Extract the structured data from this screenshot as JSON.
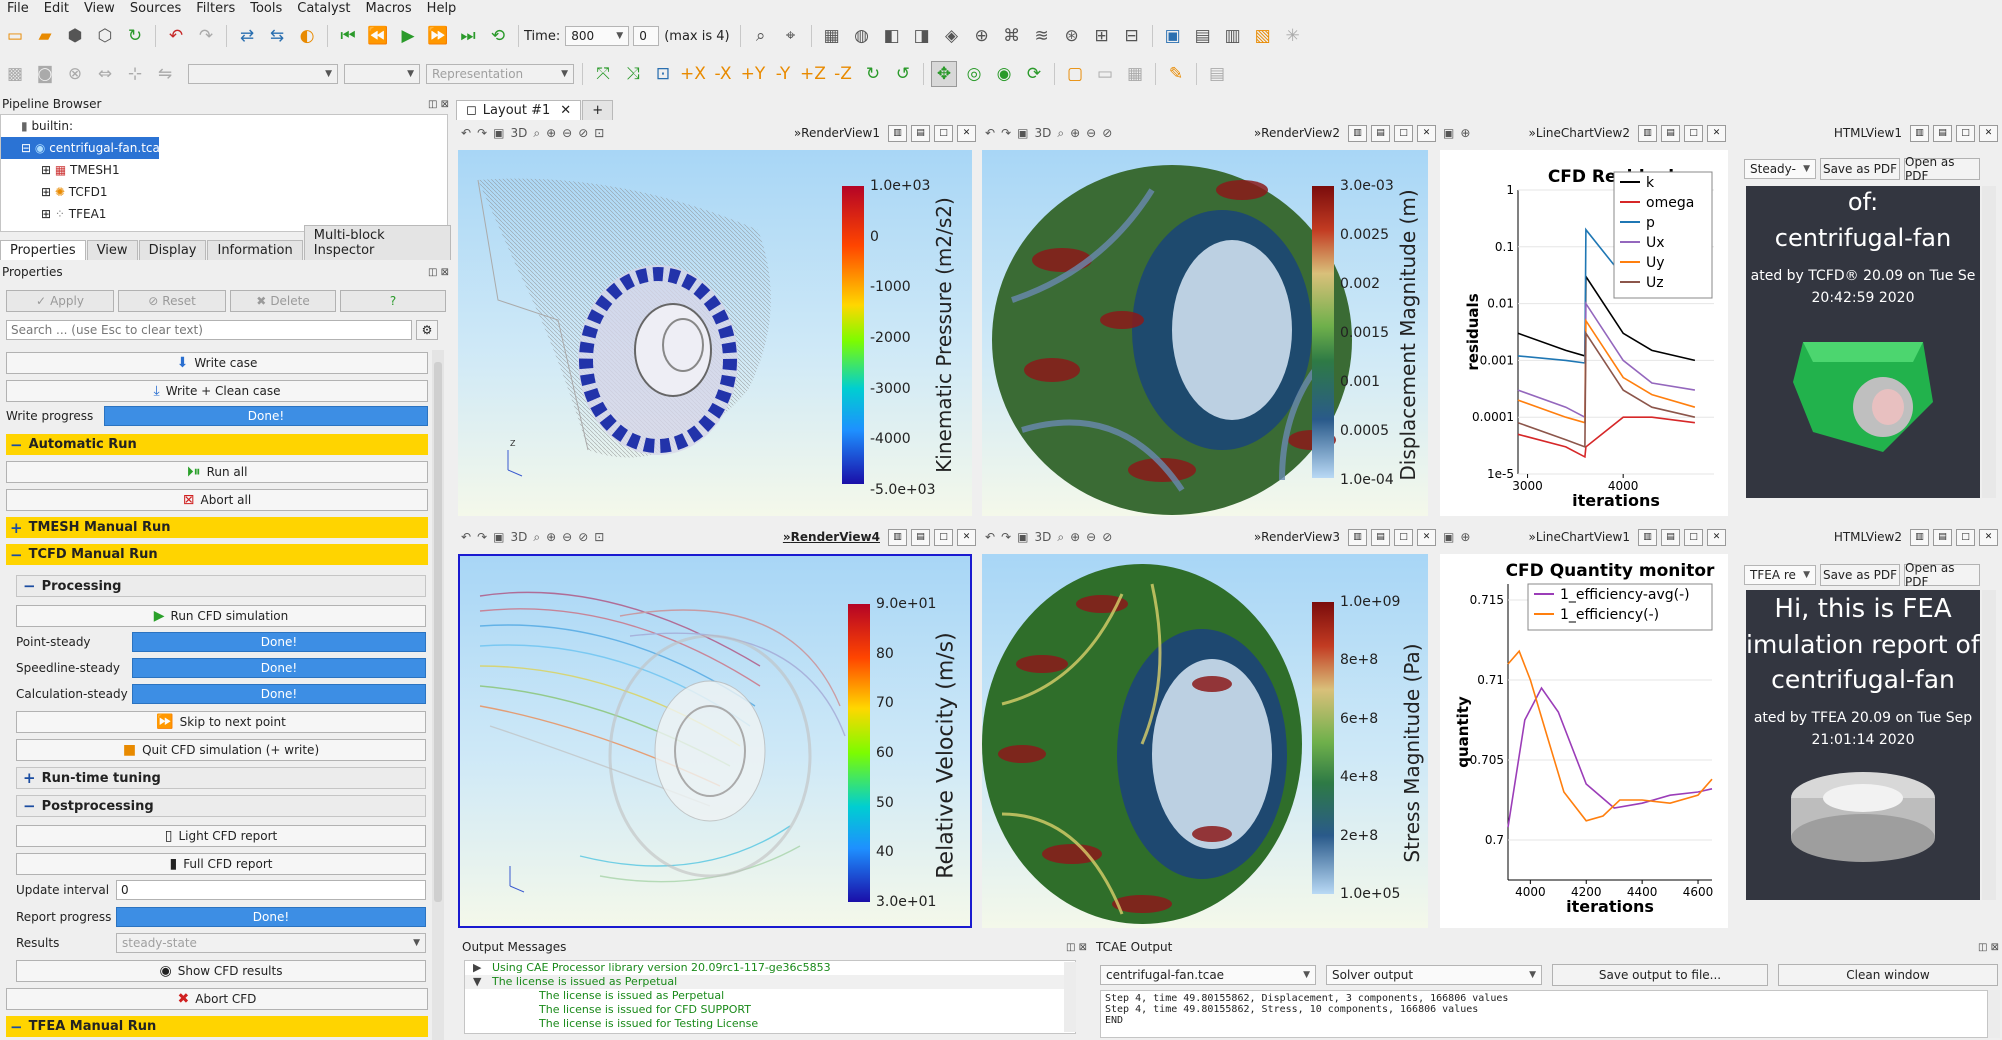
{
  "menu": [
    "File",
    "Edit",
    "View",
    "Sources",
    "Filters",
    "Tools",
    "Catalyst",
    "Macros",
    "Help"
  ],
  "toolbar": {
    "time_label": "Time:",
    "time_value": "800",
    "step_value": "0",
    "max_label": "(max is 4)",
    "representation": "Representation"
  },
  "pipeline": {
    "title": "Pipeline Browser",
    "items": [
      "builtin:",
      "centrifugal-fan.tcae",
      "TMESH1",
      "TCFD1",
      "TFEA1"
    ]
  },
  "props_tabs": [
    "Properties",
    "View",
    "Display",
    "Information",
    "Multi-block Inspector"
  ],
  "props": {
    "title": "Properties",
    "apply": "Apply",
    "reset": "Reset",
    "delete": "Delete",
    "help": "?",
    "search_placeholder": "Search ... (use Esc to clear text)",
    "write_case": "Write case",
    "write_clean": "Write + Clean case",
    "write_progress_label": "Write progress",
    "done": "Done!",
    "auto_run": "Automatic Run",
    "run_all": "Run all",
    "abort_all": "Abort all",
    "tmesh_manual": "TMESH Manual Run",
    "tcfd_manual": "TCFD Manual Run",
    "processing": "Processing",
    "run_cfd": "Run CFD simulation",
    "point_steady": "Point-steady",
    "speedline_steady": "Speedline-steady",
    "calc_steady": "Calculation-steady",
    "skip_next": "Skip to next point",
    "quit_cfd": "Quit CFD simulation (+ write)",
    "runtime_tuning": "Run-time tuning",
    "postprocessing": "Postprocessing",
    "light_report": "Light CFD report",
    "full_report": "Full CFD report",
    "update_interval_label": "Update interval",
    "update_interval_value": "0",
    "report_progress_label": "Report progress",
    "results_label": "Results",
    "results_value": "steady-state",
    "show_results": "Show CFD results",
    "abort_cfd": "Abort CFD",
    "tfea_manual": "TFEA Manual Run"
  },
  "layout_tab": "Layout #1",
  "views": {
    "rv1": "RenderView1",
    "rv2": "RenderView2",
    "lc2": "LineChartView2",
    "html1": "HTMLView1",
    "rv4": "RenderView4",
    "rv3": "RenderView3",
    "lc1": "LineChartView1",
    "html2": "HTMLView2",
    "three_d": "3D"
  },
  "colorbars": {
    "pressure": {
      "title": "Kinematic Pressure (m2/s2)",
      "ticks": [
        "1.0e+03",
        "0",
        "-1000",
        "-2000",
        "-3000",
        "-4000",
        "-5.0e+03"
      ]
    },
    "displacement": {
      "title": "Displacement Magnitude (m)",
      "ticks": [
        "3.0e-03",
        "0.0025",
        "0.002",
        "0.0015",
        "0.001",
        "0.0005",
        "1.0e-04"
      ]
    },
    "velocity": {
      "title": "Relative Velocity (m/s)",
      "ticks": [
        "9.0e+01",
        "80",
        "70",
        "60",
        "50",
        "40",
        "3.0e+01"
      ]
    },
    "stress": {
      "title": "Stress Magnitude (Pa)",
      "ticks": [
        "1.0e+09",
        "8e+8",
        "6e+8",
        "4e+8",
        "2e+8",
        "1.0e+05"
      ]
    }
  },
  "chart_data": [
    {
      "type": "line",
      "title": "CFD Residuals",
      "xlabel": "iterations",
      "ylabel": "residuals",
      "y_scale": "log",
      "xlim": [
        2900,
        4950
      ],
      "ylim": [
        1e-05,
        1
      ],
      "x_ticks": [
        "3000",
        "4000"
      ],
      "y_ticks": [
        "1",
        "0.1",
        "0.01",
        "0.001",
        "0.0001",
        "1e-5"
      ],
      "legend": "top-right",
      "series": [
        {
          "name": "k",
          "color": "#000000",
          "x": [
            2900,
            3400,
            3600,
            3610,
            4000,
            4300,
            4750
          ],
          "y": [
            0.003,
            0.0015,
            0.0012,
            0.03,
            0.003,
            0.0015,
            0.001
          ]
        },
        {
          "name": "omega",
          "color": "#d62728",
          "x": [
            2900,
            3400,
            3600,
            3610,
            4000,
            4300,
            4750
          ],
          "y": [
            5e-05,
            3e-05,
            2e-05,
            3e-05,
            0.0001,
            0.0001,
            8e-05
          ]
        },
        {
          "name": "p",
          "color": "#1f77b4",
          "x": [
            2900,
            3400,
            3600,
            3610,
            4000,
            4300,
            4750
          ],
          "y": [
            0.0012,
            0.001,
            0.0009,
            0.2,
            0.03,
            0.02,
            0.015
          ]
        },
        {
          "name": "Ux",
          "color": "#9467bd",
          "x": [
            2900,
            3400,
            3600,
            3610,
            4000,
            4300,
            4750
          ],
          "y": [
            0.0003,
            0.00015,
            0.0001,
            0.01,
            0.001,
            0.0004,
            0.0003
          ]
        },
        {
          "name": "Uy",
          "color": "#ff7f0e",
          "x": [
            2900,
            3400,
            3600,
            3610,
            4000,
            4300,
            4750
          ],
          "y": [
            0.0002,
            0.0001,
            8e-05,
            0.005,
            0.0005,
            0.00025,
            0.00015
          ]
        },
        {
          "name": "Uz",
          "color": "#8c564b",
          "x": [
            2900,
            3400,
            3600,
            3610,
            4000,
            4300,
            4750
          ],
          "y": [
            8e-05,
            4e-05,
            3e-05,
            0.003,
            0.0003,
            0.00015,
            0.0001
          ]
        }
      ]
    },
    {
      "type": "line",
      "title": "CFD Quantity monitor",
      "xlabel": "iterations",
      "ylabel": "quantity",
      "xlim": [
        3920,
        4650
      ],
      "ylim": [
        0.6975,
        0.716
      ],
      "x_ticks": [
        "4000",
        "4200",
        "4400",
        "4600"
      ],
      "y_ticks": [
        "0.715",
        "0.71",
        "0.705",
        "0.7"
      ],
      "legend": "top-left",
      "series": [
        {
          "name": "1_efficiency-avg(-)",
          "color": "#9b3db8",
          "x": [
            3920,
            3980,
            4040,
            4100,
            4200,
            4300,
            4400,
            4500,
            4600,
            4650
          ],
          "y": [
            0.7008,
            0.7075,
            0.7095,
            0.708,
            0.7035,
            0.702,
            0.7023,
            0.7028,
            0.703,
            0.7032
          ]
        },
        {
          "name": "1_efficiency(-)",
          "color": "#ff7f0e",
          "x": [
            3920,
            3960,
            4000,
            4060,
            4120,
            4200,
            4260,
            4320,
            4400,
            4500,
            4600,
            4650
          ],
          "y": [
            0.711,
            0.7118,
            0.71,
            0.7065,
            0.703,
            0.7012,
            0.7015,
            0.7025,
            0.7025,
            0.7023,
            0.7028,
            0.7038
          ]
        }
      ]
    }
  ],
  "html1": {
    "combo": "Steady-",
    "save_pdf": "Save as PDF",
    "open_pdf": "Open as PDF",
    "text1": "of:",
    "text2": "centrifugal-fan",
    "text3": "ated by TCFD® 20.09 on Tue Se",
    "text4": "20:42:59 2020"
  },
  "html2": {
    "combo": "TFEA re",
    "save_pdf": "Save as PDF",
    "open_pdf": "Open as PDF",
    "text1": "Hi, this is FEA",
    "text2": "imulation report of:",
    "text3": "centrifugal-fan",
    "text4": "ated by TFEA 20.09 on Tue Sep",
    "text5": "21:01:14 2020"
  },
  "output": {
    "title": "Output Messages",
    "lines": [
      "Using CAE Processor library version 20.09rc1-117-ge36c5853",
      "The license is issued as  Perpetual",
      "The license is issued as  Perpetual",
      "The license is issued for CFD SUPPORT",
      "The license is issued for Testing License"
    ]
  },
  "tcae": {
    "title": "TCAE Output",
    "file_combo": "centrifugal-fan.tcae",
    "kind_combo": "Solver output",
    "save_btn": "Save output to file...",
    "clean_btn": "Clean window",
    "lines": [
      "Step 4, time 49.80155862, Displacement, 3 components, 166806 values",
      "Step 4, time 49.80155862, Stress, 10 components, 166806 values",
      "END"
    ]
  }
}
